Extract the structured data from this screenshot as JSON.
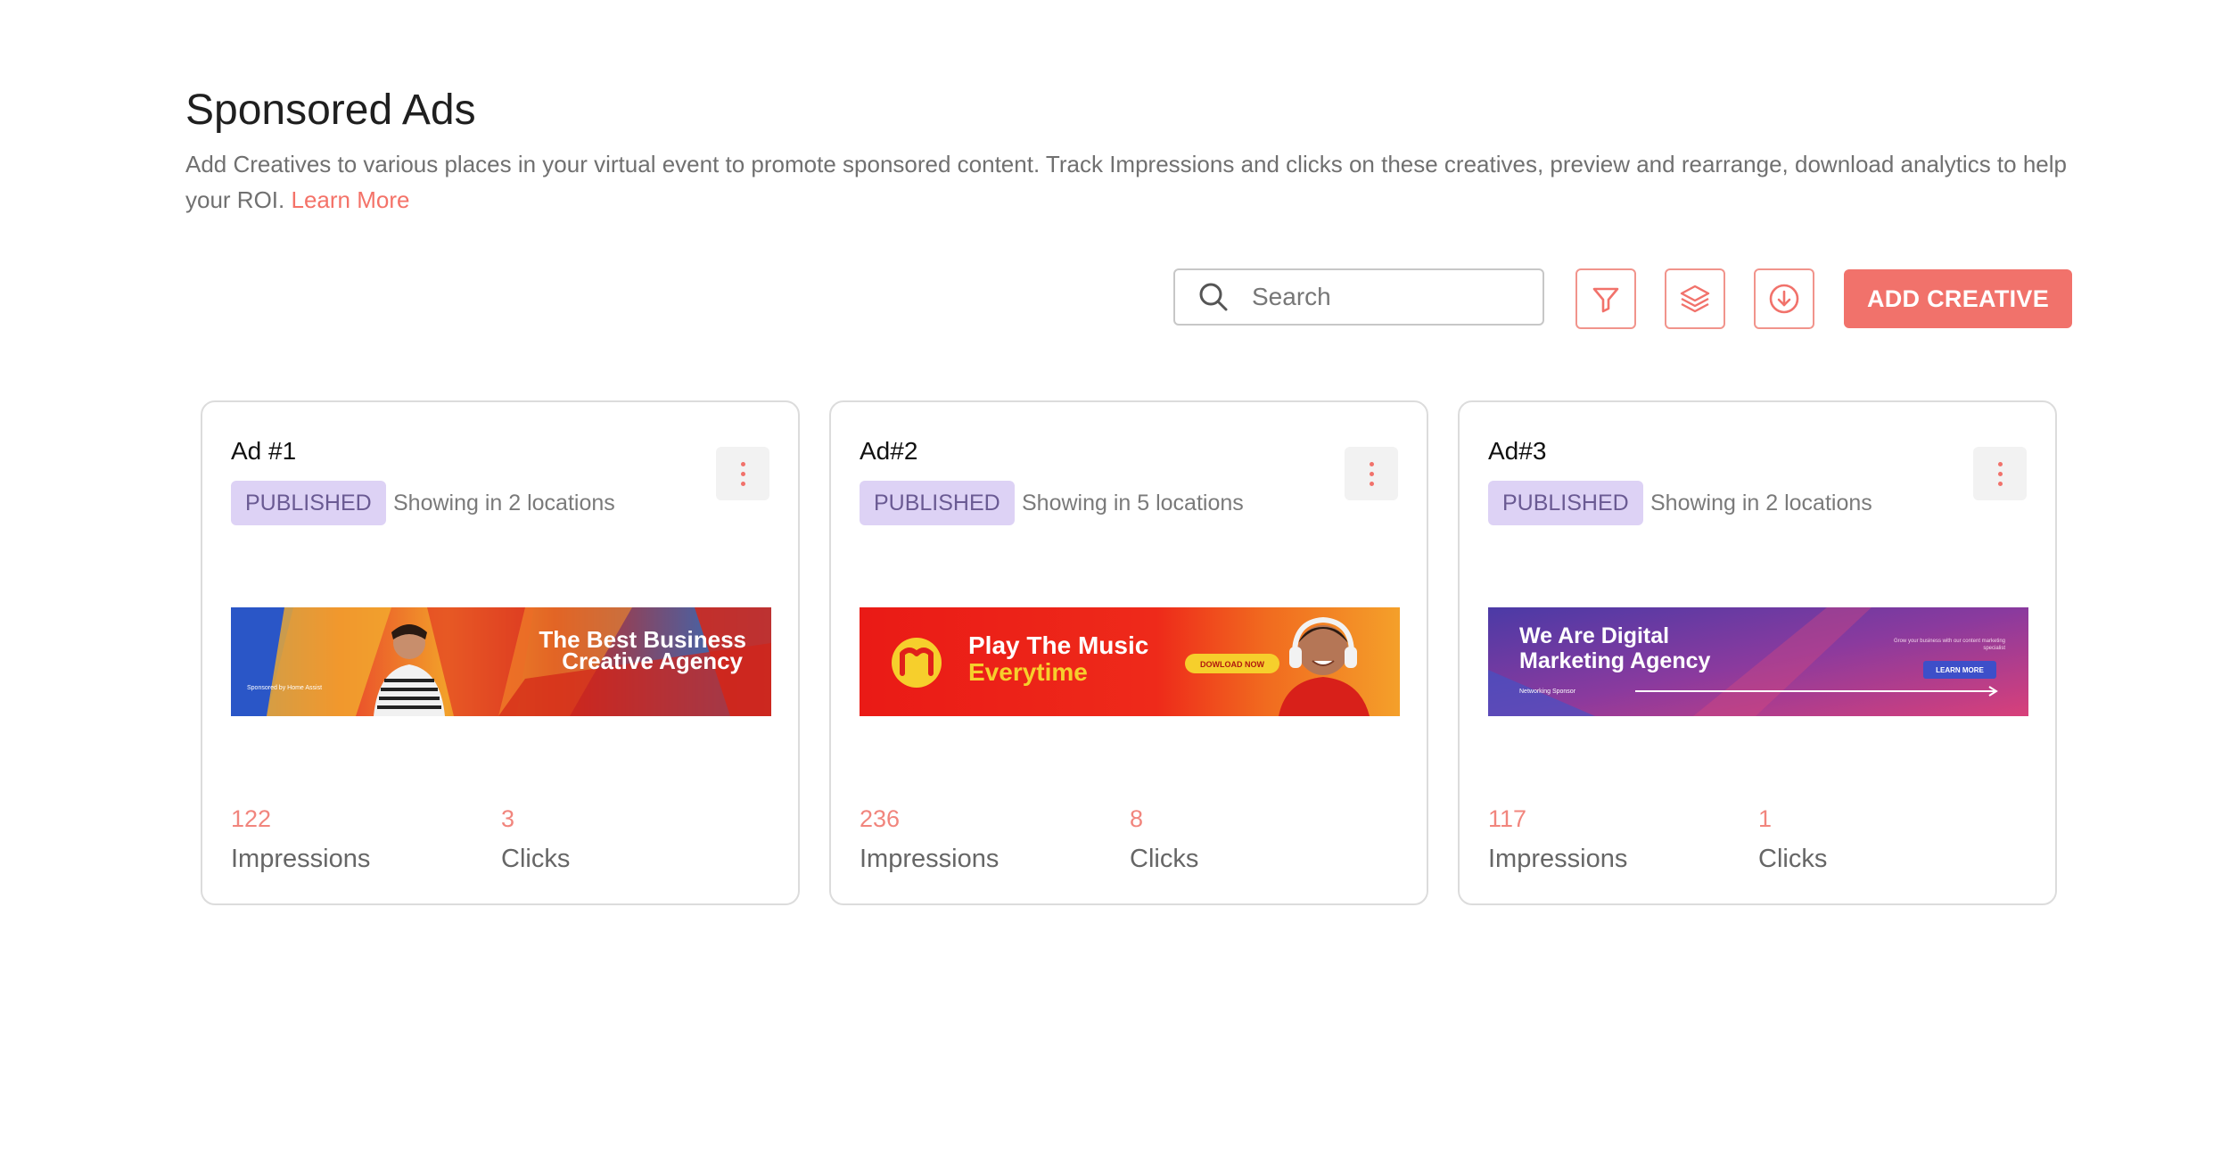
{
  "page": {
    "title": "Sponsored Ads",
    "description": "Add Creatives to various places in your virtual event to promote sponsored content. Track Impressions and clicks on these creatives, preview and rearrange, download analytics to help your ROI.",
    "learn_more": "Learn More"
  },
  "toolbar": {
    "search_placeholder": "Search",
    "add_button_label": "ADD CREATIVE",
    "icons": [
      "search-icon",
      "filter-icon",
      "layers-icon",
      "download-icon"
    ]
  },
  "colors": {
    "accent": "#f1726b",
    "badge_bg": "#ddd2f5",
    "badge_text": "#6a5a93"
  },
  "cards": [
    {
      "title": "Ad #1",
      "status": "PUBLISHED",
      "locations": "Showing in 2 locations",
      "banner": {
        "headline_1": "The Best Business",
        "headline_2": "Creative Agency",
        "sponsor_line": "Sponsored by Home Assist"
      },
      "impressions": "122",
      "impressions_label": "Impressions",
      "clicks": "3",
      "clicks_label": "Clicks"
    },
    {
      "title": "Ad#2",
      "status": "PUBLISHED",
      "locations": "Showing in 5 locations",
      "banner": {
        "headline_1": "Play The Music",
        "headline_2": "Everytime",
        "cta": "DOWLOAD NOW"
      },
      "impressions": "236",
      "impressions_label": "Impressions",
      "clicks": "8",
      "clicks_label": "Clicks"
    },
    {
      "title": "Ad#3",
      "status": "PUBLISHED",
      "locations": "Showing in 2 locations",
      "banner": {
        "headline_1": "We Are Digital",
        "headline_2": "Marketing Agency",
        "sponsor_line": "Networking Sponsor",
        "side_text": "Grow your business with our content marketing specialist",
        "cta": "LEARN MORE"
      },
      "impressions": "117",
      "impressions_label": "Impressions",
      "clicks": "1",
      "clicks_label": "Clicks"
    }
  ]
}
